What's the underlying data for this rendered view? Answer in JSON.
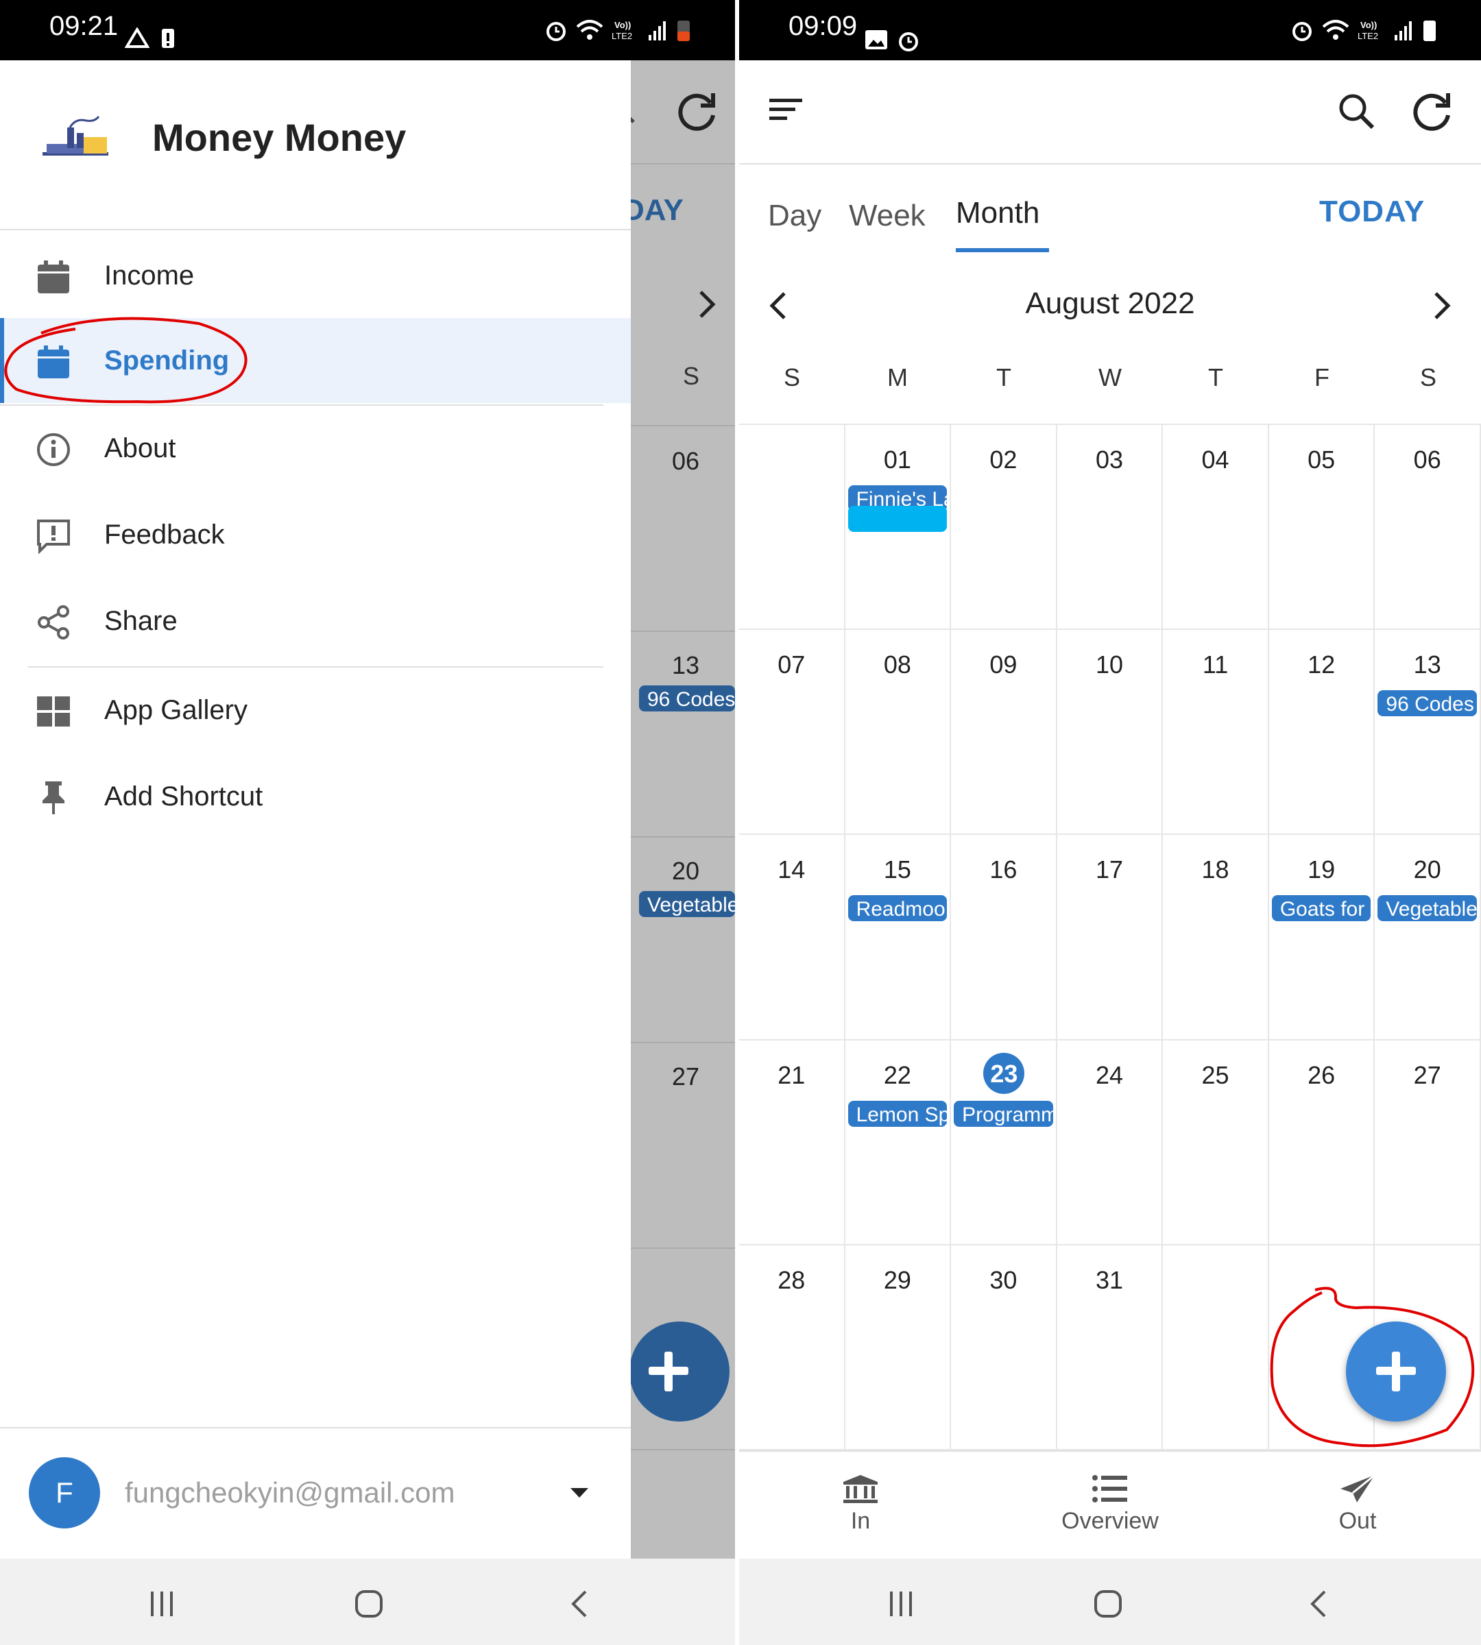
{
  "left_screen": {
    "status_time": "09:21",
    "app_title": "Money Money",
    "menu": [
      {
        "label": "Income",
        "icon": "calendar-icon"
      },
      {
        "label": "Spending",
        "icon": "calendar-icon",
        "active": true
      },
      {
        "label": "About",
        "icon": "info-icon"
      },
      {
        "label": "Feedback",
        "icon": "feedback-icon"
      },
      {
        "label": "Share",
        "icon": "share-icon"
      },
      {
        "label": "App Gallery",
        "icon": "grid-icon"
      },
      {
        "label": "Add Shortcut",
        "icon": "pin-icon"
      }
    ],
    "account": {
      "initial": "F",
      "email": "fungcheokyin@gmail.com"
    },
    "behind": {
      "today_fragment": "DAY",
      "weekday": "S",
      "days": [
        "06",
        "13",
        "20",
        "27"
      ],
      "events": {
        "13": "96 Codes",
        "20": "Vegetable"
      }
    }
  },
  "right_screen": {
    "status_time": "09:09",
    "tabs": {
      "day": "Day",
      "week": "Week",
      "month": "Month",
      "today": "TODAY"
    },
    "month_title": "August 2022",
    "weekdays": [
      "S",
      "M",
      "T",
      "W",
      "T",
      "F",
      "S"
    ],
    "weeks": [
      [
        "",
        "01",
        "02",
        "03",
        "04",
        "05",
        "06"
      ],
      [
        "07",
        "08",
        "09",
        "10",
        "11",
        "12",
        "13"
      ],
      [
        "14",
        "15",
        "16",
        "17",
        "18",
        "19",
        "20"
      ],
      [
        "21",
        "22",
        "23",
        "24",
        "25",
        "26",
        "27"
      ],
      [
        "28",
        "29",
        "30",
        "31",
        "",
        "",
        ""
      ]
    ],
    "today_day": "23",
    "events": [
      {
        "week": 0,
        "day": 1,
        "slot": 0,
        "label": "Finnie's La"
      },
      {
        "week": 0,
        "day": 1,
        "slot": 1,
        "label": "",
        "redacted": true
      },
      {
        "week": 1,
        "day": 6,
        "slot": 0,
        "label": "96 Codes"
      },
      {
        "week": 2,
        "day": 1,
        "slot": 0,
        "label": "Readmoo"
      },
      {
        "week": 2,
        "day": 5,
        "slot": 0,
        "label": "Goats for"
      },
      {
        "week": 2,
        "day": 6,
        "slot": 0,
        "label": "Vegetable"
      },
      {
        "week": 3,
        "day": 1,
        "slot": 0,
        "label": "Lemon Sp"
      },
      {
        "week": 3,
        "day": 2,
        "slot": 0,
        "label": "Programm"
      }
    ],
    "bottom_nav": [
      {
        "label": "In",
        "icon": "bank-icon"
      },
      {
        "label": "Overview",
        "icon": "list-icon"
      },
      {
        "label": "Out",
        "icon": "send-icon"
      }
    ]
  },
  "colors": {
    "accent": "#2f7ac8",
    "fab": "#3b86d6",
    "annotation": "#e00000"
  }
}
